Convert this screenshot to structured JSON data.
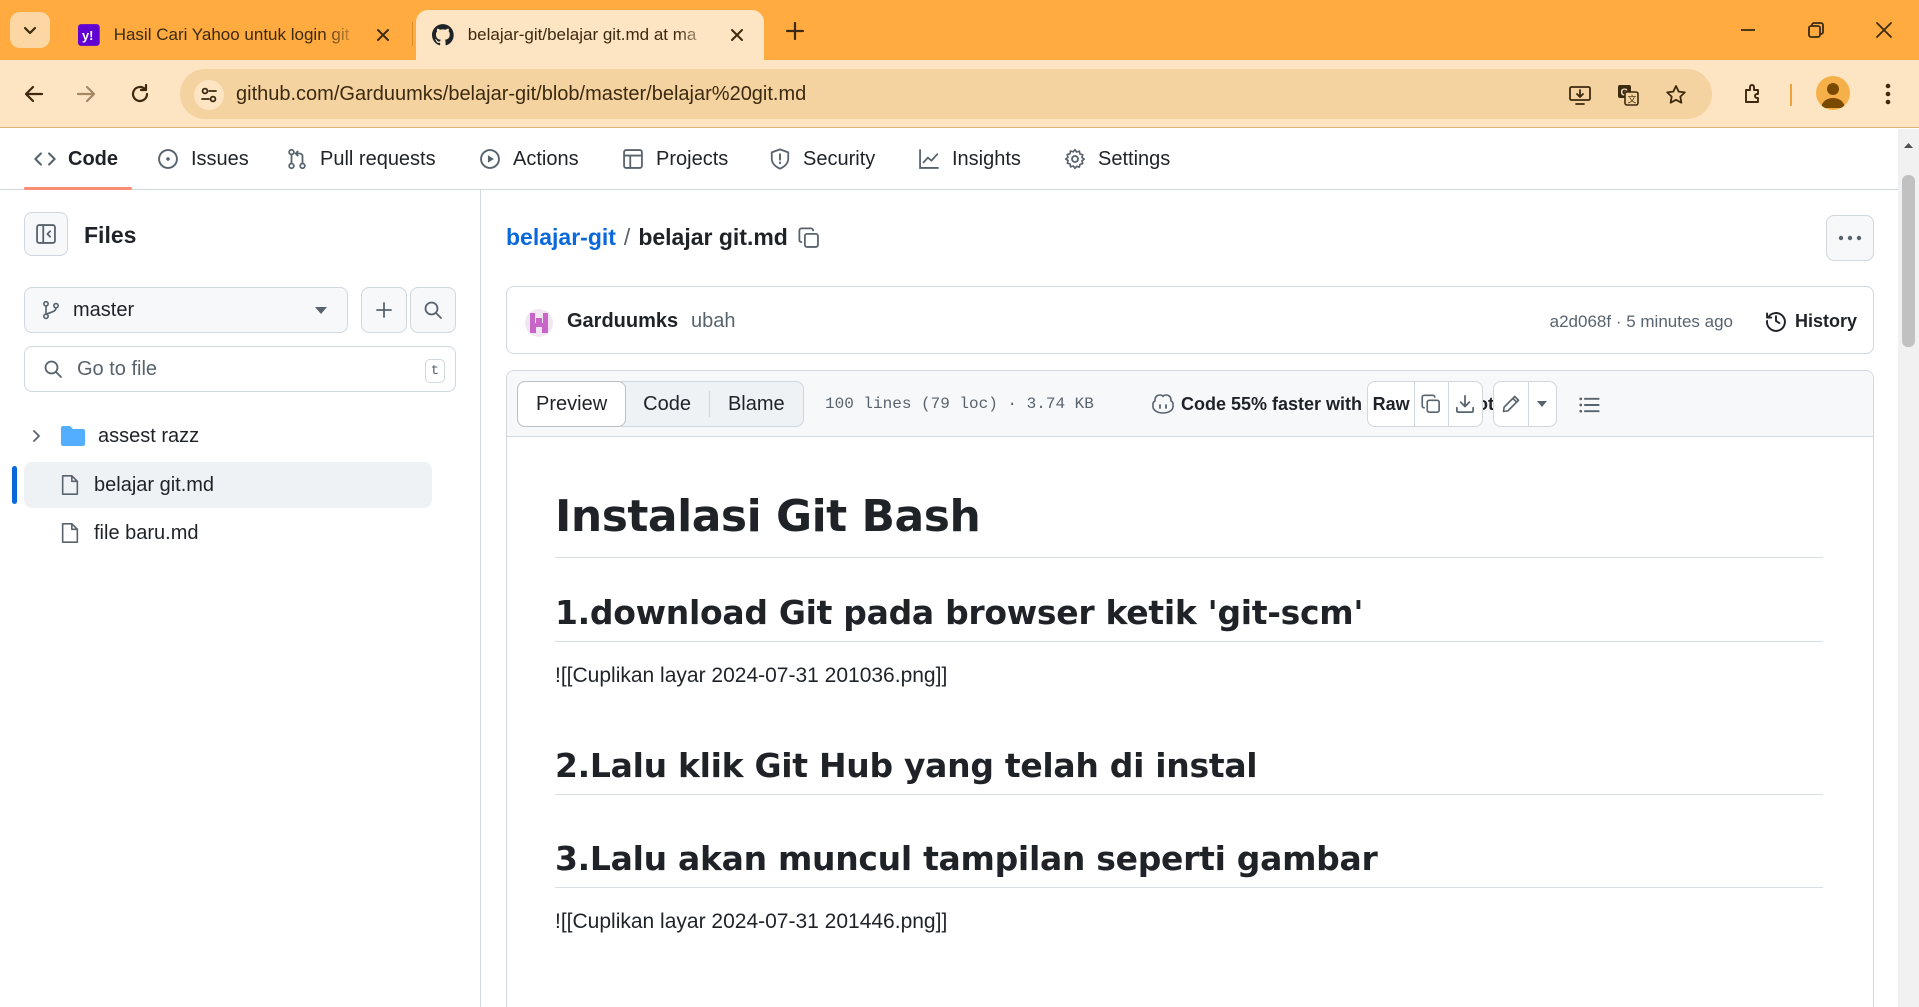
{
  "browser": {
    "tabs": [
      {
        "title": "Hasil Cari Yahoo untuk login git",
        "favicon": "yahoo-icon"
      },
      {
        "title": "belajar-git/belajar git.md at ma",
        "favicon": "github-icon"
      }
    ],
    "url": "github.com/Garduumks/belajar-git/blob/master/belajar%20git.md"
  },
  "repo_nav": {
    "items": [
      "Code",
      "Issues",
      "Pull requests",
      "Actions",
      "Projects",
      "Security",
      "Insights",
      "Settings"
    ],
    "active": "Code"
  },
  "sidebar": {
    "title": "Files",
    "branch": "master",
    "go_to_file_placeholder": "Go to file",
    "go_to_file_shortcut": "t",
    "tree": [
      {
        "type": "folder",
        "name": "assest razz"
      },
      {
        "type": "file",
        "name": "belajar git.md",
        "selected": true
      },
      {
        "type": "file",
        "name": "file baru.md"
      }
    ]
  },
  "breadcrumb": {
    "repo": "belajar-git",
    "separator": "/",
    "file": "belajar git.md"
  },
  "commit": {
    "author": "Garduumks",
    "message": "ubah",
    "meta": "a2d068f · 5 minutes ago",
    "history_label": "History"
  },
  "file_header": {
    "tabs": [
      "Preview",
      "Code",
      "Blame"
    ],
    "active_tab": "Preview",
    "meta": "100 lines (79 loc) · 3.74 KB",
    "copilot_text": "Code 55% faster with GitHub Copilot",
    "raw_label": "Raw"
  },
  "content": {
    "h1": "Instalasi Git Bash",
    "h2_1": "1.download Git pada browser ketik 'git-scm'",
    "p_1": "![[Cuplikan layar 2024-07-31 201036.png]]",
    "h2_2": "2.Lalu klik Git Hub yang telah di instal",
    "h2_3": "3.Lalu akan muncul tampilan seperti gambar",
    "p_2": "![[Cuplikan layar 2024-07-31 201446.png]]"
  },
  "colors": {
    "chrome_tabstrip": "#ffab40",
    "chrome_toolbar": "#fde4c2",
    "link": "#0969da",
    "nav_underline": "#fd8c73"
  }
}
